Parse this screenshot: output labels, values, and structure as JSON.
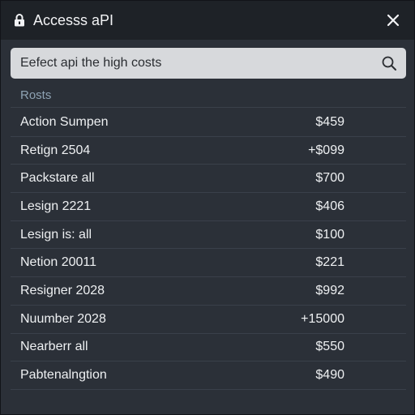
{
  "window": {
    "title": "Accesss aPI"
  },
  "search": {
    "value": "Eefect api the high costs"
  },
  "section": {
    "header": "Rosts"
  },
  "rows": [
    {
      "name": "Action Sumpen",
      "price": "$459"
    },
    {
      "name": "Retign 2504",
      "price": "+$099"
    },
    {
      "name": "Packstare all",
      "price": "$700"
    },
    {
      "name": "Lesign 2221",
      "price": "$406"
    },
    {
      "name": "Lesign is: all",
      "price": "$100"
    },
    {
      "name": "Netion 20011",
      "price": "$221"
    },
    {
      "name": "Resigner 2028",
      "price": "$992"
    },
    {
      "name": "Nuumber 2028",
      "price": "+15000"
    },
    {
      "name": "Nearberr all",
      "price": "$550"
    },
    {
      "name": "Pabtenalngtion",
      "price": "$490"
    }
  ],
  "icons": {
    "title": "lock-icon",
    "close": "close-icon",
    "search": "search-icon"
  },
  "colors": {
    "titlebar": "#1e2227",
    "panel": "#2b3038",
    "search_field": "#d7d9dc",
    "section_header_text": "#8ea2b3"
  }
}
